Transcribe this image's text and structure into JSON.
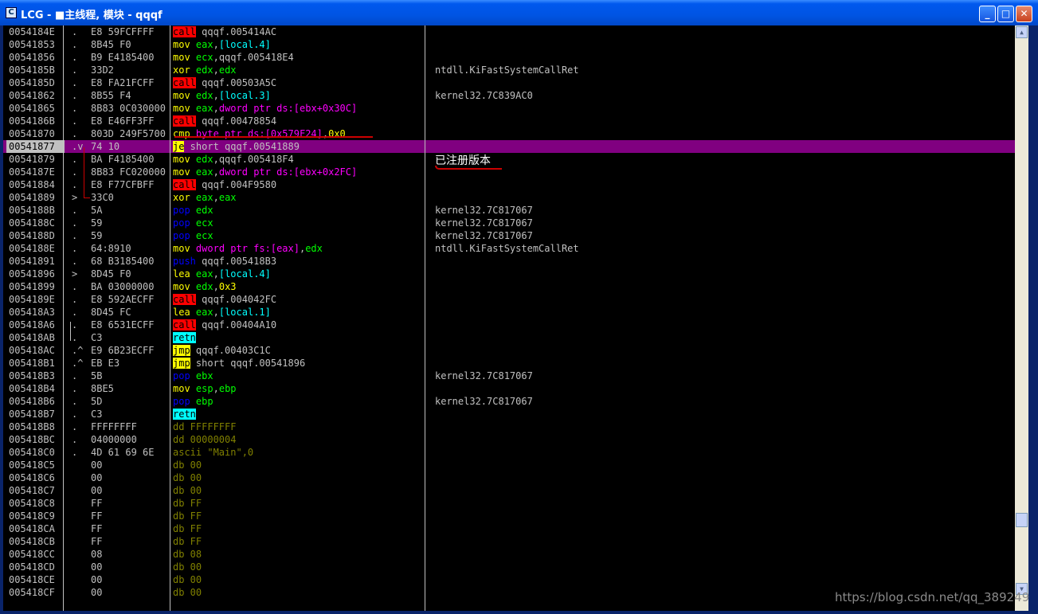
{
  "window": {
    "title": "LCG - ■主线程, 模块 - qqqf",
    "min": "_",
    "max": "□",
    "close": "✕"
  },
  "annotation": "已注册版本",
  "watermark": "https://blog.csdn.net/qq_389249",
  "rows": [
    {
      "addr": "0054184E",
      "mark": ".",
      "hex": "E8 59FCFFFF",
      "asm": [
        [
          "call",
          "red"
        ],
        [
          " qqqf.005414AC",
          ""
        ]
      ],
      "cmt": ""
    },
    {
      "addr": "00541853",
      "mark": ".",
      "hex": "8B45 F0",
      "asm": [
        [
          "mov",
          "yel-text"
        ],
        [
          " ",
          ""
        ],
        [
          "eax",
          "reg"
        ],
        [
          ",",
          ""
        ],
        [
          "[local.4]",
          "bracket"
        ]
      ],
      "cmt": ""
    },
    {
      "addr": "00541856",
      "mark": ".",
      "hex": "B9 E4185400",
      "asm": [
        [
          "mov",
          "yel-text"
        ],
        [
          " ",
          ""
        ],
        [
          "ecx",
          "reg"
        ],
        [
          ",qqqf.005418E4",
          ""
        ]
      ],
      "cmt": ""
    },
    {
      "addr": "0054185B",
      "mark": ".",
      "hex": "33D2",
      "asm": [
        [
          "xor",
          "yel-text"
        ],
        [
          " ",
          ""
        ],
        [
          "edx",
          "reg"
        ],
        [
          ",",
          ""
        ],
        [
          "edx",
          "reg"
        ]
      ],
      "cmt": "ntdll.KiFastSystemCallRet"
    },
    {
      "addr": "0054185D",
      "mark": ".",
      "hex": "E8 FA21FCFF",
      "asm": [
        [
          "call",
          "red"
        ],
        [
          " qqqf.00503A5C",
          ""
        ]
      ],
      "cmt": ""
    },
    {
      "addr": "00541862",
      "mark": ".",
      "hex": "8B55 F4",
      "asm": [
        [
          "mov",
          "yel-text"
        ],
        [
          " ",
          ""
        ],
        [
          "edx",
          "reg"
        ],
        [
          ",",
          ""
        ],
        [
          "[local.3]",
          "bracket"
        ]
      ],
      "cmt": "kernel32.7C839AC0"
    },
    {
      "addr": "00541865",
      "mark": ".",
      "hex": "8B83 0C030000",
      "asm": [
        [
          "mov",
          "yel-text"
        ],
        [
          " ",
          ""
        ],
        [
          "eax",
          "reg"
        ],
        [
          ",",
          ""
        ],
        [
          "dword ptr ds:[ebx+0x30C]",
          "mem"
        ]
      ],
      "cmt": ""
    },
    {
      "addr": "0054186B",
      "mark": ".",
      "hex": "E8 E46FF3FF",
      "asm": [
        [
          "call",
          "red"
        ],
        [
          " qqqf.00478854",
          ""
        ]
      ],
      "cmt": ""
    },
    {
      "addr": "00541870",
      "mark": ".",
      "hex": "803D 249F5700",
      "asm": [
        [
          "cmp",
          "yel-text"
        ],
        [
          " ",
          ""
        ],
        [
          "byte ptr ds:[0x579F24]",
          "mem"
        ],
        [
          ",",
          ""
        ],
        [
          "0x0",
          "num"
        ]
      ],
      "cmt": ""
    },
    {
      "addr": "00541877",
      "mark": ".v",
      "hex": "74 10",
      "asm": [
        [
          "je",
          "yel"
        ],
        [
          " short qqqf.00541889",
          ""
        ]
      ],
      "cmt": "",
      "sel": true
    },
    {
      "addr": "00541879",
      "mark": ".",
      "hex": "BA F4185400",
      "asm": [
        [
          "mov",
          "yel-text"
        ],
        [
          " ",
          ""
        ],
        [
          "edx",
          "reg"
        ],
        [
          ",qqqf.005418F4",
          ""
        ]
      ],
      "cmt": ""
    },
    {
      "addr": "0054187E",
      "mark": ".",
      "hex": "8B83 FC020000",
      "asm": [
        [
          "mov",
          "yel-text"
        ],
        [
          " ",
          ""
        ],
        [
          "eax",
          "reg"
        ],
        [
          ",",
          ""
        ],
        [
          "dword ptr ds:[ebx+0x2FC]",
          "mem"
        ]
      ],
      "cmt": ""
    },
    {
      "addr": "00541884",
      "mark": ".",
      "hex": "E8 F77CFBFF",
      "asm": [
        [
          "call",
          "red"
        ],
        [
          " qqqf.004F9580",
          ""
        ]
      ],
      "cmt": ""
    },
    {
      "addr": "00541889",
      "mark": ">",
      "hex": "33C0",
      "asm": [
        [
          "xor",
          "yel-text"
        ],
        [
          " ",
          ""
        ],
        [
          "eax",
          "reg"
        ],
        [
          ",",
          ""
        ],
        [
          "eax",
          "reg"
        ]
      ],
      "cmt": ""
    },
    {
      "addr": "0054188B",
      "mark": ".",
      "hex": "5A",
      "asm": [
        [
          "pop",
          "blue"
        ],
        [
          " ",
          ""
        ],
        [
          "edx",
          "reg"
        ]
      ],
      "cmt": "kernel32.7C817067"
    },
    {
      "addr": "0054188C",
      "mark": ".",
      "hex": "59",
      "asm": [
        [
          "pop",
          "blue"
        ],
        [
          " ",
          ""
        ],
        [
          "ecx",
          "reg"
        ]
      ],
      "cmt": "kernel32.7C817067"
    },
    {
      "addr": "0054188D",
      "mark": ".",
      "hex": "59",
      "asm": [
        [
          "pop",
          "blue"
        ],
        [
          " ",
          ""
        ],
        [
          "ecx",
          "reg"
        ]
      ],
      "cmt": "kernel32.7C817067"
    },
    {
      "addr": "0054188E",
      "mark": ".",
      "hex": "64:8910",
      "asm": [
        [
          "mov",
          "yel-text"
        ],
        [
          " ",
          ""
        ],
        [
          "dword ptr fs:[eax]",
          "mem"
        ],
        [
          ",",
          ""
        ],
        [
          "edx",
          "reg"
        ]
      ],
      "cmt": "ntdll.KiFastSystemCallRet"
    },
    {
      "addr": "00541891",
      "mark": ".",
      "hex": "68 B3185400",
      "asm": [
        [
          "push",
          "blue"
        ],
        [
          " qqqf.005418B3",
          ""
        ]
      ],
      "cmt": ""
    },
    {
      "addr": "00541896",
      "mark": ">",
      "hex": "8D45 F0",
      "asm": [
        [
          "lea",
          "yel-text"
        ],
        [
          " ",
          ""
        ],
        [
          "eax",
          "reg"
        ],
        [
          ",",
          ""
        ],
        [
          "[local.4]",
          "bracket"
        ]
      ],
      "cmt": ""
    },
    {
      "addr": "00541899",
      "mark": ".",
      "hex": "BA 03000000",
      "asm": [
        [
          "mov",
          "yel-text"
        ],
        [
          " ",
          ""
        ],
        [
          "edx",
          "reg"
        ],
        [
          ",",
          ""
        ],
        [
          "0x3",
          "num"
        ]
      ],
      "cmt": ""
    },
    {
      "addr": "0054189E",
      "mark": ".",
      "hex": "E8 592AECFF",
      "asm": [
        [
          "call",
          "red"
        ],
        [
          " qqqf.004042FC",
          ""
        ]
      ],
      "cmt": ""
    },
    {
      "addr": "005418A3",
      "mark": ".",
      "hex": "8D45 FC",
      "asm": [
        [
          "lea",
          "yel-text"
        ],
        [
          " ",
          ""
        ],
        [
          "eax",
          "reg"
        ],
        [
          ",",
          ""
        ],
        [
          "[local.1]",
          "bracket"
        ]
      ],
      "cmt": ""
    },
    {
      "addr": "005418A6",
      "mark": ".",
      "hex": "E8 6531ECFF",
      "asm": [
        [
          "call",
          "red"
        ],
        [
          " qqqf.00404A10",
          ""
        ]
      ],
      "cmt": ""
    },
    {
      "addr": "005418AB",
      "mark": ".",
      "hex": "C3",
      "asm": [
        [
          "retn",
          "cyan"
        ]
      ],
      "cmt": ""
    },
    {
      "addr": "005418AC",
      "mark": ".^",
      "hex": "E9 6B23ECFF",
      "asm": [
        [
          "jmp",
          "yel"
        ],
        [
          " qqqf.00403C1C",
          ""
        ]
      ],
      "cmt": ""
    },
    {
      "addr": "005418B1",
      "mark": ".^",
      "hex": "EB E3",
      "asm": [
        [
          "jmp",
          "yel"
        ],
        [
          " short qqqf.00541896",
          ""
        ]
      ],
      "cmt": ""
    },
    {
      "addr": "005418B3",
      "mark": ".",
      "hex": "5B",
      "asm": [
        [
          "pop",
          "blue"
        ],
        [
          " ",
          ""
        ],
        [
          "ebx",
          "reg"
        ]
      ],
      "cmt": "kernel32.7C817067"
    },
    {
      "addr": "005418B4",
      "mark": ".",
      "hex": "8BE5",
      "asm": [
        [
          "mov",
          "yel-text"
        ],
        [
          " ",
          ""
        ],
        [
          "esp",
          "reg"
        ],
        [
          ",",
          ""
        ],
        [
          "ebp",
          "reg"
        ]
      ],
      "cmt": ""
    },
    {
      "addr": "005418B6",
      "mark": ".",
      "hex": "5D",
      "asm": [
        [
          "pop",
          "blue"
        ],
        [
          " ",
          ""
        ],
        [
          "ebp",
          "reg"
        ]
      ],
      "cmt": "kernel32.7C817067"
    },
    {
      "addr": "005418B7",
      "mark": ".",
      "hex": "C3",
      "asm": [
        [
          "retn",
          "cyan"
        ]
      ],
      "cmt": ""
    },
    {
      "addr": "005418B8",
      "mark": ".",
      "hex": "FFFFFFFF",
      "asm": [
        [
          "dd FFFFFFFF",
          "dd"
        ]
      ],
      "cmt": ""
    },
    {
      "addr": "005418BC",
      "mark": ".",
      "hex": "04000000",
      "asm": [
        [
          "dd 00000004",
          "dd"
        ]
      ],
      "cmt": ""
    },
    {
      "addr": "005418C0",
      "mark": ".",
      "hex": "4D 61 69 6E",
      "asm": [
        [
          "ascii \"Main\",0",
          "dd"
        ]
      ],
      "cmt": ""
    },
    {
      "addr": "005418C5",
      "mark": "",
      "hex": "00",
      "asm": [
        [
          "db 00",
          "dd"
        ]
      ],
      "cmt": ""
    },
    {
      "addr": "005418C6",
      "mark": "",
      "hex": "00",
      "asm": [
        [
          "db 00",
          "dd"
        ]
      ],
      "cmt": ""
    },
    {
      "addr": "005418C7",
      "mark": "",
      "hex": "00",
      "asm": [
        [
          "db 00",
          "dd"
        ]
      ],
      "cmt": ""
    },
    {
      "addr": "005418C8",
      "mark": "",
      "hex": "FF",
      "asm": [
        [
          "db FF",
          "dd"
        ]
      ],
      "cmt": ""
    },
    {
      "addr": "005418C9",
      "mark": "",
      "hex": "FF",
      "asm": [
        [
          "db FF",
          "dd"
        ]
      ],
      "cmt": ""
    },
    {
      "addr": "005418CA",
      "mark": "",
      "hex": "FF",
      "asm": [
        [
          "db FF",
          "dd"
        ]
      ],
      "cmt": ""
    },
    {
      "addr": "005418CB",
      "mark": "",
      "hex": "FF",
      "asm": [
        [
          "db FF",
          "dd"
        ]
      ],
      "cmt": ""
    },
    {
      "addr": "005418CC",
      "mark": "",
      "hex": "08",
      "asm": [
        [
          "db 08",
          "dd"
        ]
      ],
      "cmt": ""
    },
    {
      "addr": "005418CD",
      "mark": "",
      "hex": "00",
      "asm": [
        [
          "db 00",
          "dd"
        ]
      ],
      "cmt": ""
    },
    {
      "addr": "005418CE",
      "mark": "",
      "hex": "00",
      "asm": [
        [
          "db 00",
          "dd"
        ]
      ],
      "cmt": ""
    },
    {
      "addr": "005418CF",
      "mark": "",
      "hex": "00",
      "asm": [
        [
          "db 00",
          "dd"
        ]
      ],
      "cmt": ""
    }
  ]
}
